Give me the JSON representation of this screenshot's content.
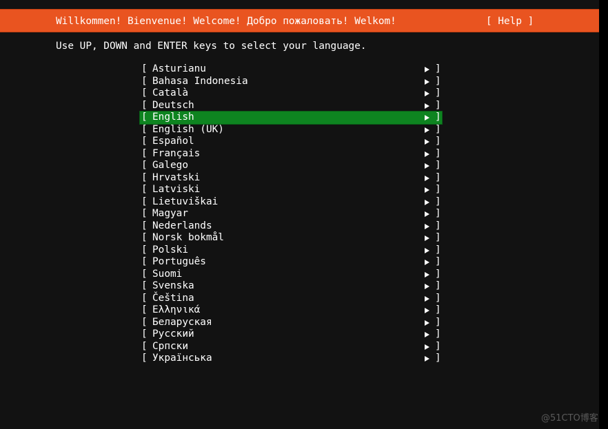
{
  "header": {
    "title": "Willkommen! Bienvenue! Welcome! Добро пожаловать! Welkom!",
    "help_label": "[ Help ]"
  },
  "instructions": "Use UP, DOWN and ENTER keys to select your language.",
  "colors": {
    "header_bg": "#e95420",
    "selected_bg": "#0e8420",
    "screen_bg": "#121212"
  },
  "languages": [
    {
      "label": "Asturianu",
      "selected": false
    },
    {
      "label": "Bahasa Indonesia",
      "selected": false
    },
    {
      "label": "Català",
      "selected": false
    },
    {
      "label": "Deutsch",
      "selected": false
    },
    {
      "label": "English",
      "selected": true
    },
    {
      "label": "English (UK)",
      "selected": false
    },
    {
      "label": "Español",
      "selected": false
    },
    {
      "label": "Français",
      "selected": false
    },
    {
      "label": "Galego",
      "selected": false
    },
    {
      "label": "Hrvatski",
      "selected": false
    },
    {
      "label": "Latviski",
      "selected": false
    },
    {
      "label": "Lietuviškai",
      "selected": false
    },
    {
      "label": "Magyar",
      "selected": false
    },
    {
      "label": "Nederlands",
      "selected": false
    },
    {
      "label": "Norsk bokmål",
      "selected": false
    },
    {
      "label": "Polski",
      "selected": false
    },
    {
      "label": "Português",
      "selected": false
    },
    {
      "label": "Suomi",
      "selected": false
    },
    {
      "label": "Svenska",
      "selected": false
    },
    {
      "label": "Čeština",
      "selected": false
    },
    {
      "label": "Ελληνικά",
      "selected": false
    },
    {
      "label": "Беларуская",
      "selected": false
    },
    {
      "label": "Русский",
      "selected": false
    },
    {
      "label": "Српски",
      "selected": false
    },
    {
      "label": "Українська",
      "selected": false
    }
  ],
  "list_glyphs": {
    "bracket_left": "[",
    "bracket_right": "]",
    "arrow_icon": "right-triangle"
  },
  "watermark": "@51CTO博客"
}
